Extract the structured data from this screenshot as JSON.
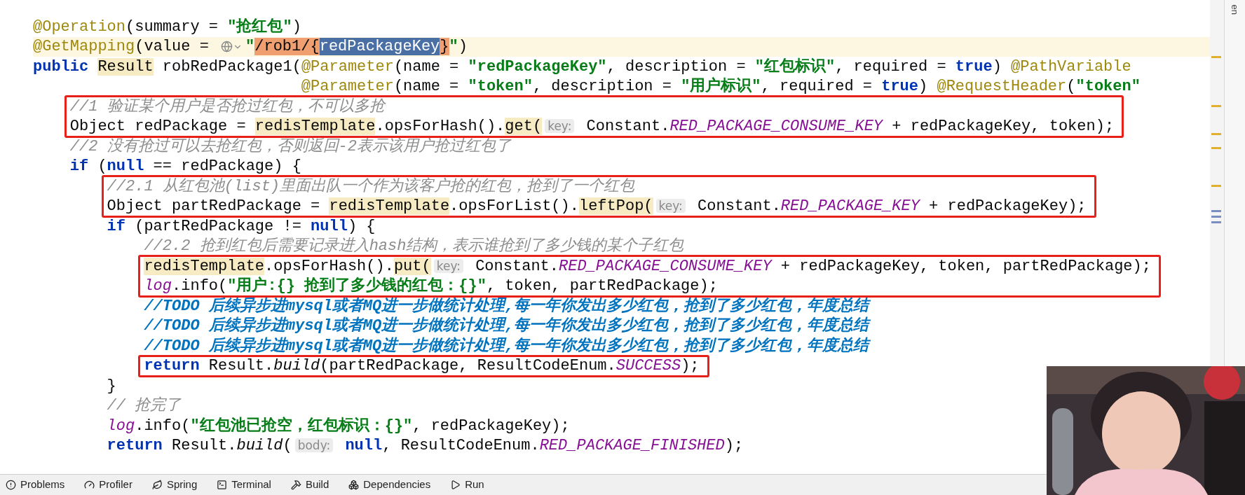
{
  "right_strip_label": "en",
  "code": [
    {
      "boxed": false,
      "lines": [
        {
          "current": false,
          "tokens": [
            {
              "kind": "annotation",
              "text": "@Operation"
            },
            {
              "kind": "plain",
              "text": "(summary = "
            },
            {
              "kind": "string",
              "text": "\"抢红包\""
            },
            {
              "kind": "plain",
              "text": ")"
            }
          ]
        },
        {
          "current": true,
          "tokens": [
            {
              "kind": "annotation",
              "text": "@GetMapping"
            },
            {
              "kind": "plain",
              "text": "(value = "
            },
            {
              "kind": "link-icon"
            },
            {
              "kind": "string",
              "text": "\""
            },
            {
              "kind": "injected",
              "text": "/rob1/{"
            },
            {
              "kind": "selected",
              "text": "redPackageKey"
            },
            {
              "kind": "injected",
              "text": "}"
            },
            {
              "kind": "string",
              "text": "\""
            },
            {
              "kind": "plain",
              "text": ")"
            }
          ]
        },
        {
          "current": false,
          "tokens": [
            {
              "kind": "keyword",
              "text": "public "
            },
            {
              "kind": "usage",
              "text": "Result"
            },
            {
              "kind": "plain",
              "text": " robRedPackage1("
            },
            {
              "kind": "annotation",
              "text": "@Parameter"
            },
            {
              "kind": "plain",
              "text": "(name = "
            },
            {
              "kind": "string",
              "text": "\"redPackageKey\""
            },
            {
              "kind": "plain",
              "text": ", description = "
            },
            {
              "kind": "string",
              "text": "\"红包标识\""
            },
            {
              "kind": "plain",
              "text": ", required = "
            },
            {
              "kind": "keyword",
              "text": "true"
            },
            {
              "kind": "plain",
              "text": ") "
            },
            {
              "kind": "annotation",
              "text": "@PathVariable"
            }
          ]
        },
        {
          "current": false,
          "tokens": [
            {
              "kind": "annotation",
              "text": "                             @Parameter"
            },
            {
              "kind": "plain",
              "text": "(name = "
            },
            {
              "kind": "string",
              "text": "\"token\""
            },
            {
              "kind": "plain",
              "text": ", description = "
            },
            {
              "kind": "string",
              "text": "\"用户标识\""
            },
            {
              "kind": "plain",
              "text": ", required = "
            },
            {
              "kind": "keyword",
              "text": "true"
            },
            {
              "kind": "plain",
              "text": ") "
            },
            {
              "kind": "annotation",
              "text": "@RequestHeader"
            },
            {
              "kind": "plain",
              "text": "("
            },
            {
              "kind": "string",
              "text": "\"token\""
            }
          ]
        }
      ]
    },
    {
      "boxed": true,
      "lines": [
        {
          "current": false,
          "tokens": [
            {
              "kind": "comment",
              "text": "    //1 验证某个用户是否抢过红包，不可以多抢"
            }
          ]
        },
        {
          "current": false,
          "tokens": [
            {
              "kind": "plain",
              "text": "    Object redPackage = "
            },
            {
              "kind": "usage",
              "text": "redisTemplate"
            },
            {
              "kind": "plain",
              "text": ".opsForHash()."
            },
            {
              "kind": "usage",
              "text": "get("
            },
            {
              "kind": "hint",
              "text": "key:"
            },
            {
              "kind": "plain",
              "text": " Constant."
            },
            {
              "kind": "field",
              "text": "RED_PACKAGE_CONSUME_KEY"
            },
            {
              "kind": "plain",
              "text": " + redPackageKey, token);"
            }
          ]
        }
      ]
    },
    {
      "boxed": false,
      "lines": [
        {
          "current": false,
          "tokens": [
            {
              "kind": "comment",
              "text": "    //2 没有抢过可以去抢红包，否则返回-2表示该用户抢过红包了"
            }
          ]
        },
        {
          "current": false,
          "tokens": [
            {
              "kind": "keyword",
              "text": "    if"
            },
            {
              "kind": "plain",
              "text": " ("
            },
            {
              "kind": "keyword",
              "text": "null"
            },
            {
              "kind": "plain",
              "text": " == redPackage) {"
            }
          ]
        }
      ]
    },
    {
      "boxed": true,
      "lines": [
        {
          "current": false,
          "tokens": [
            {
              "kind": "comment",
              "text": "        //2.1 从红包池(list)里面出队一个作为该客户抢的红包，抢到了一个红包"
            }
          ]
        },
        {
          "current": false,
          "tokens": [
            {
              "kind": "plain",
              "text": "        Object partRedPackage = "
            },
            {
              "kind": "usage",
              "text": "redisTemplate"
            },
            {
              "kind": "plain",
              "text": ".opsForList()."
            },
            {
              "kind": "usage",
              "text": "leftPop("
            },
            {
              "kind": "hint",
              "text": "key:"
            },
            {
              "kind": "plain",
              "text": " Constant."
            },
            {
              "kind": "field",
              "text": "RED_PACKAGE_KEY"
            },
            {
              "kind": "plain",
              "text": " + redPackageKey);"
            }
          ]
        }
      ]
    },
    {
      "boxed": false,
      "lines": [
        {
          "current": false,
          "tokens": [
            {
              "kind": "keyword",
              "text": "        if"
            },
            {
              "kind": "plain",
              "text": " (partRedPackage != "
            },
            {
              "kind": "keyword",
              "text": "null"
            },
            {
              "kind": "plain",
              "text": ") {"
            }
          ]
        },
        {
          "current": false,
          "tokens": [
            {
              "kind": "comment",
              "text": "            //2.2 抢到红包后需要记录进入hash结构，表示谁抢到了多少钱的某个子红包"
            }
          ]
        }
      ]
    },
    {
      "boxed": true,
      "lines": [
        {
          "current": false,
          "tokens": [
            {
              "kind": "usage",
              "text": "            redisTemplate"
            },
            {
              "kind": "plain",
              "text": ".opsForHash()."
            },
            {
              "kind": "usage",
              "text": "put("
            },
            {
              "kind": "hint",
              "text": "key:"
            },
            {
              "kind": "plain",
              "text": " Constant."
            },
            {
              "kind": "field",
              "text": "RED_PACKAGE_CONSUME_KEY"
            },
            {
              "kind": "plain",
              "text": " + redPackageKey, token, partRedPackage);"
            }
          ]
        },
        {
          "current": false,
          "tokens": [
            {
              "kind": "field",
              "text": "            log"
            },
            {
              "kind": "plain",
              "text": ".info("
            },
            {
              "kind": "string",
              "text": "\"用户:{} 抢到了多少钱的红包：{}\""
            },
            {
              "kind": "plain",
              "text": ", token, partRedPackage);"
            }
          ]
        }
      ]
    },
    {
      "boxed": false,
      "lines": [
        {
          "current": false,
          "tokens": [
            {
              "kind": "todo",
              "text": "            //TODO 后续异步进mysql或者MQ进一步做统计处理,每一年你发出多少红包，抢到了多少红包，年度总结"
            }
          ]
        },
        {
          "current": false,
          "tokens": [
            {
              "kind": "todo",
              "text": "            //TODO 后续异步进mysql或者MQ进一步做统计处理,每一年你发出多少红包，抢到了多少红包，年度总结"
            }
          ]
        },
        {
          "current": false,
          "tokens": [
            {
              "kind": "todo",
              "text": "            //TODO 后续异步进mysql或者MQ进一步做统计处理,每一年你发出多少红包，抢到了多少红包，年度总结"
            }
          ]
        }
      ]
    },
    {
      "boxed": true,
      "lines": [
        {
          "current": false,
          "tokens": [
            {
              "kind": "keyword",
              "text": "            return"
            },
            {
              "kind": "plain",
              "text": " Result."
            },
            {
              "kind": "static",
              "text": "build"
            },
            {
              "kind": "plain",
              "text": "(partRedPackage, ResultCodeEnum."
            },
            {
              "kind": "field",
              "text": "SUCCESS"
            },
            {
              "kind": "plain",
              "text": ");"
            }
          ]
        }
      ]
    },
    {
      "boxed": false,
      "lines": [
        {
          "current": false,
          "tokens": [
            {
              "kind": "plain",
              "text": "        }"
            }
          ]
        },
        {
          "current": false,
          "tokens": [
            {
              "kind": "comment",
              "text": "        // 抢完了"
            }
          ]
        },
        {
          "current": false,
          "tokens": [
            {
              "kind": "field",
              "text": "        log"
            },
            {
              "kind": "plain",
              "text": ".info("
            },
            {
              "kind": "string",
              "text": "\"红包池已抢空，红包标识：{}\""
            },
            {
              "kind": "plain",
              "text": ", redPackageKey);"
            }
          ]
        },
        {
          "current": false,
          "tokens": [
            {
              "kind": "keyword",
              "text": "        return"
            },
            {
              "kind": "plain",
              "text": " Result."
            },
            {
              "kind": "static",
              "text": "build"
            },
            {
              "kind": "plain",
              "text": "("
            },
            {
              "kind": "hint",
              "text": "body:"
            },
            {
              "kind": "keyword",
              "text": " null"
            },
            {
              "kind": "plain",
              "text": ", ResultCodeEnum."
            },
            {
              "kind": "field",
              "text": "RED_PACKAGE_FINISHED"
            },
            {
              "kind": "plain",
              "text": ");"
            }
          ]
        }
      ]
    }
  ],
  "tool_tabs": [
    {
      "kind": "problems",
      "label": "Problems"
    },
    {
      "kind": "profiler",
      "label": "Profiler"
    },
    {
      "kind": "spring",
      "label": "Spring"
    },
    {
      "kind": "terminal",
      "label": "Terminal"
    },
    {
      "kind": "build",
      "label": "Build"
    },
    {
      "kind": "dependencies",
      "label": "Dependencies"
    },
    {
      "kind": "run",
      "label": "Run"
    }
  ]
}
